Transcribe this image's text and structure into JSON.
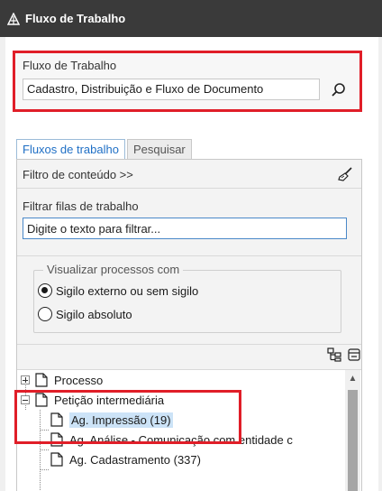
{
  "window": {
    "title": "Fluxo de Trabalho"
  },
  "workflow": {
    "label": "Fluxo de Trabalho",
    "value": "Cadastro, Distribuição e Fluxo de Documento"
  },
  "tabs": [
    {
      "label": "Fluxos de trabalho",
      "active": true
    },
    {
      "label": "Pesquisar",
      "active": false
    }
  ],
  "filter": {
    "header": "Filtro de conteúdo >>",
    "queues_label": "Filtrar filas de trabalho",
    "queues_placeholder": "Digite o texto para filtrar..."
  },
  "visibility": {
    "legend": "Visualizar processos com",
    "options": [
      {
        "label": "Sigilo externo ou sem sigilo",
        "checked": true
      },
      {
        "label": "Sigilo absoluto",
        "checked": false
      }
    ]
  },
  "tree": {
    "items": [
      {
        "label": "Processo",
        "level": 0,
        "expander": "plus"
      },
      {
        "label": "Petição intermediária",
        "level": 0,
        "expander": "minus"
      },
      {
        "label": "Ag. Impressão (19)",
        "level": 1,
        "selected": true
      },
      {
        "label": "Ag. Análise - Comunicação com entidade c",
        "level": 1
      },
      {
        "label": "Ag. Cadastramento (337)",
        "level": 1
      }
    ]
  },
  "colors": {
    "highlight": "#e01e28",
    "accent": "#1f6fc5",
    "titlebar": "#3a3a3a"
  }
}
